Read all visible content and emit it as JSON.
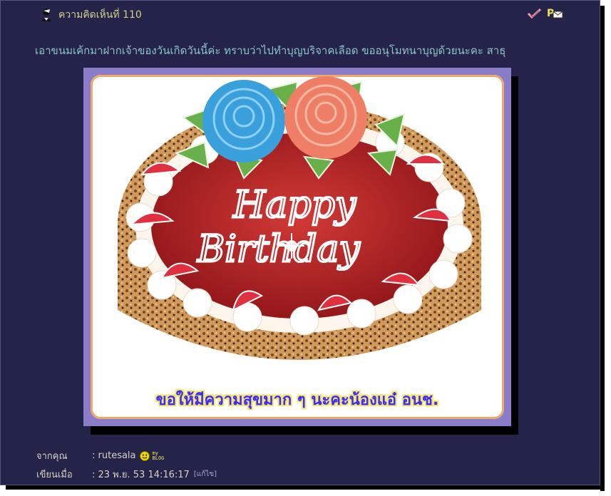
{
  "comment": {
    "title": "ความคิดเห็นที่ 110",
    "icon": "user-silhouette-icon",
    "actions": [
      {
        "name": "approve-icon"
      },
      {
        "name": "private-message-icon"
      }
    ]
  },
  "message": "เอาขนมเค้กมาฝากเจ้าของวันเกิดวันนี้ค่ะ ทราบว่าไปทำบุญบริจาคเลือด ขออนุโมทนาบุญด้วยนะคะ สาธุ",
  "image": {
    "cake_text_1": "Happy",
    "cake_text_2": "Birthday",
    "caption": "ขอให้มีความสุขมาก ๆ นะคะน้องแอ๋ อนช."
  },
  "footer": {
    "from_label": "จากคุณ",
    "from_value": ": rutesala",
    "blog_badge_1": "my",
    "blog_badge_2": "BLOG",
    "date_label": "เขียนเมื่อ",
    "date_value": ": 23 พ.ย. 53 14:16:17",
    "edit_label": "[แก้ไข]"
  },
  "colors": {
    "panel_bg": "#24244a",
    "title": "#d6cf8c",
    "message": "#8fc1c8",
    "caption": "#3a2cff",
    "frame": "#8a7cc9"
  }
}
